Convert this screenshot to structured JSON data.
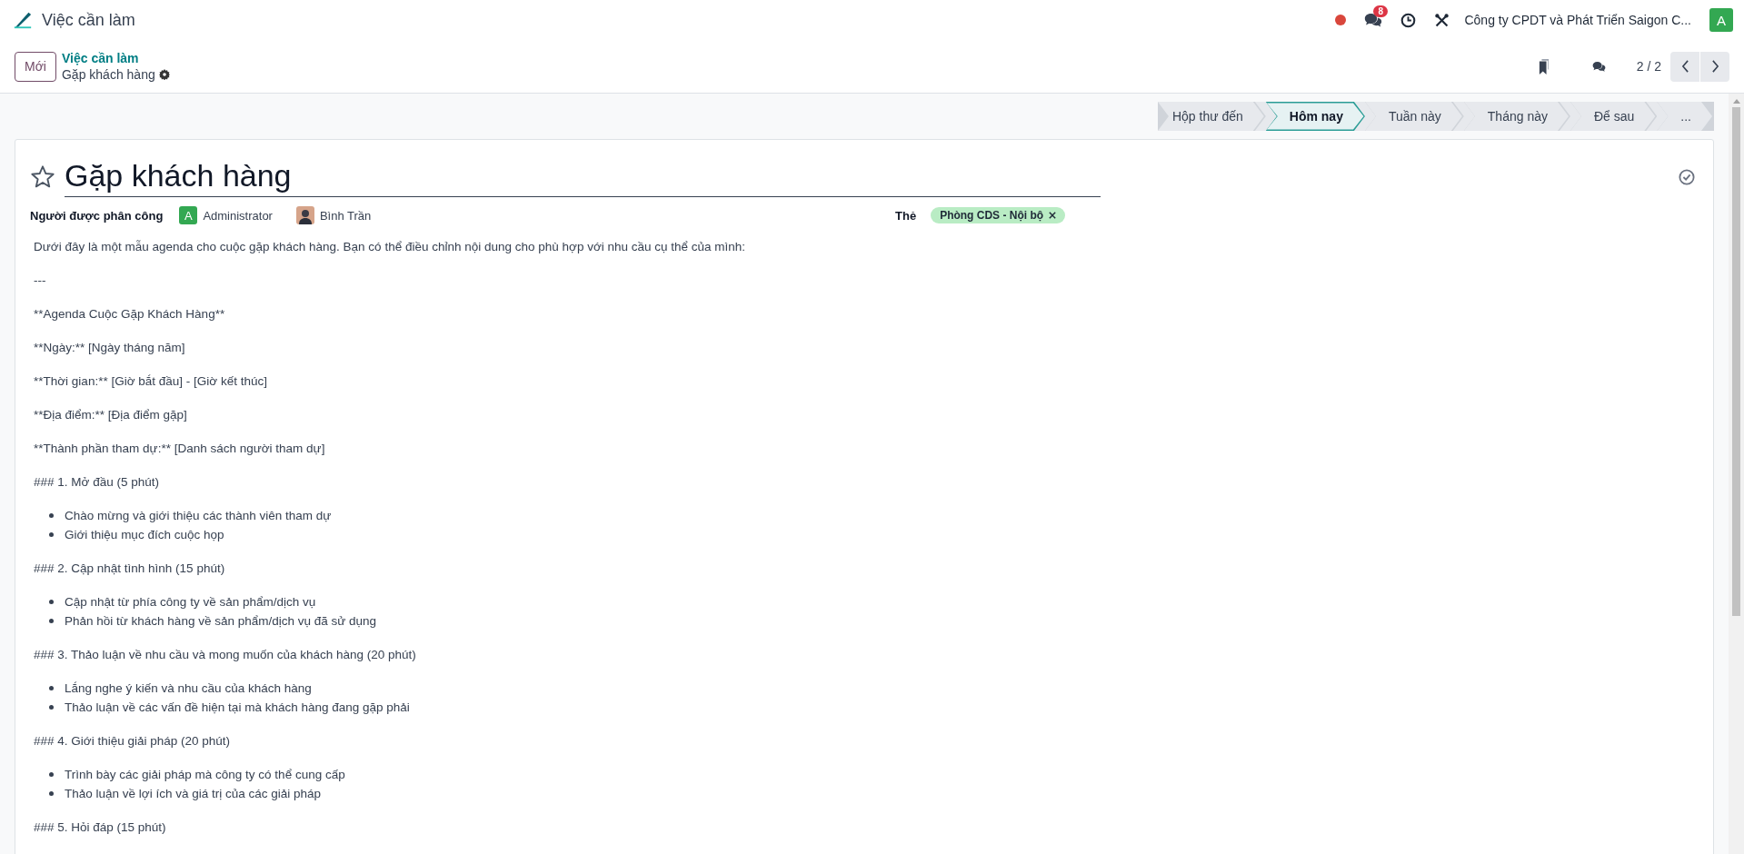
{
  "app": {
    "title": "Việc cần làm"
  },
  "systray": {
    "messages_badge": "8",
    "company": "Công ty CPDT và Phát Triển Saigon C...",
    "user_initial": "A"
  },
  "control_panel": {
    "new_button": "Mới",
    "breadcrumb": "Việc cần làm",
    "record_name": "Gặp khách hàng",
    "pager": "2 / 2"
  },
  "stages": [
    {
      "label": "Hộp thư đến",
      "selected": false
    },
    {
      "label": "Hôm nay",
      "selected": true
    },
    {
      "label": "Tuần này",
      "selected": false
    },
    {
      "label": "Tháng này",
      "selected": false
    },
    {
      "label": "Để sau",
      "selected": false
    },
    {
      "label": "...",
      "selected": false
    }
  ],
  "record": {
    "favorite": false,
    "title": "Gặp khách hàng",
    "assignees_label": "Người được phân công",
    "assignees": [
      {
        "kind": "initial",
        "initial": "A",
        "name": "Administrator"
      },
      {
        "kind": "photo",
        "name": "Bình Trần"
      }
    ],
    "tags_label": "Thẻ",
    "tags": [
      {
        "label": "Phòng CDS - Nội bộ",
        "color": "#b9ecc4"
      }
    ]
  },
  "body": [
    {
      "kind": "paragraph",
      "text": "Dưới đây là một mẫu agenda cho cuộc gặp khách hàng. Bạn có thể điều chỉnh nội dung cho phù hợp với nhu cầu cụ thể của mình:"
    },
    {
      "kind": "paragraph",
      "text": "---"
    },
    {
      "kind": "paragraph",
      "text": "**Agenda Cuộc Gặp Khách Hàng**"
    },
    {
      "kind": "paragraph",
      "text": "**Ngày:** [Ngày tháng năm]"
    },
    {
      "kind": "paragraph",
      "text": "**Thời gian:** [Giờ bắt đầu] - [Giờ kết thúc]"
    },
    {
      "kind": "paragraph",
      "text": "**Địa điểm:** [Địa điểm gặp]"
    },
    {
      "kind": "paragraph",
      "text": "**Thành phần tham dự:** [Danh sách người tham dự]"
    },
    {
      "kind": "paragraph",
      "text": "### 1. Mở đầu (5 phút)"
    },
    {
      "kind": "list",
      "items": [
        "Chào mừng và giới thiệu các thành viên tham dự",
        "Giới thiệu mục đích cuộc họp"
      ]
    },
    {
      "kind": "paragraph",
      "text": "### 2. Cập nhật tình hình (15 phút)"
    },
    {
      "kind": "list",
      "items": [
        "Cập nhật từ phía công ty về sản phẩm/dịch vụ",
        "Phản hồi từ khách hàng về sản phẩm/dịch vụ đã sử dụng"
      ]
    },
    {
      "kind": "paragraph",
      "text": "### 3. Thảo luận về nhu cầu và mong muốn của khách hàng (20 phút)"
    },
    {
      "kind": "list",
      "items": [
        "Lắng nghe ý kiến và nhu cầu của khách hàng",
        "Thảo luận về các vấn đề hiện tại mà khách hàng đang gặp phải"
      ]
    },
    {
      "kind": "paragraph",
      "text": "### 4. Giới thiệu giải pháp (20 phút)"
    },
    {
      "kind": "list",
      "items": [
        "Trình bày các giải pháp mà công ty có thể cung cấp",
        "Thảo luận về lợi ích và giá trị của các giải pháp"
      ]
    },
    {
      "kind": "paragraph",
      "text": "### 5. Hỏi đáp (15 phút)"
    }
  ]
}
